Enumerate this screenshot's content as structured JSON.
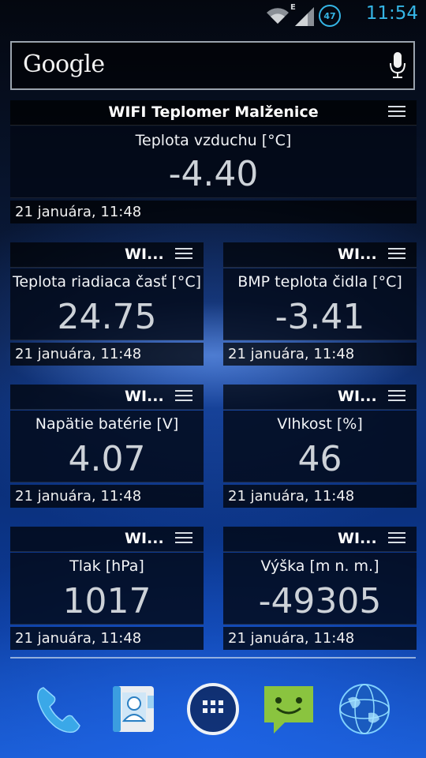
{
  "status_bar": {
    "time": "11:54",
    "battery_level": "47",
    "network_type": "E",
    "icons": [
      "wifi-icon",
      "signal-icon",
      "battery-icon"
    ]
  },
  "search": {
    "label": "Google",
    "icon": "mic-icon"
  },
  "widgets": [
    {
      "title": "WIFI Teplomer Malženice",
      "label": "Teplota vzduchu [°C]",
      "value": "-4.40",
      "date": "21 januára, 11:48"
    },
    {
      "title": "WI...",
      "label": "Teplota riadiaca časť [°C]",
      "value": "24.75",
      "date": "21 januára, 11:48"
    },
    {
      "title": "WI...",
      "label": "BMP teplota čidla [°C]",
      "value": "-3.41",
      "date": "21 januára, 11:48"
    },
    {
      "title": "WI...",
      "label": "Napätie batérie [V]",
      "value": "4.07",
      "date": "21 januára, 11:48"
    },
    {
      "title": "WI...",
      "label": "Vlhkost [%]",
      "value": "46",
      "date": "21 januára, 11:48"
    },
    {
      "title": "WI...",
      "label": "Tlak [hPa]",
      "value": "1017",
      "date": "21 januára, 11:48"
    },
    {
      "title": "WI...",
      "label": "Výška [m n. m.]",
      "value": "-49305",
      "date": "21 januára, 11:48"
    }
  ],
  "dock": [
    "phone-icon",
    "contacts-icon",
    "app-drawer-icon",
    "messaging-icon",
    "browser-icon"
  ],
  "colors": {
    "accent": "#35b5e5",
    "text": "#ffffff",
    "value_text": "#cdd2d8"
  }
}
